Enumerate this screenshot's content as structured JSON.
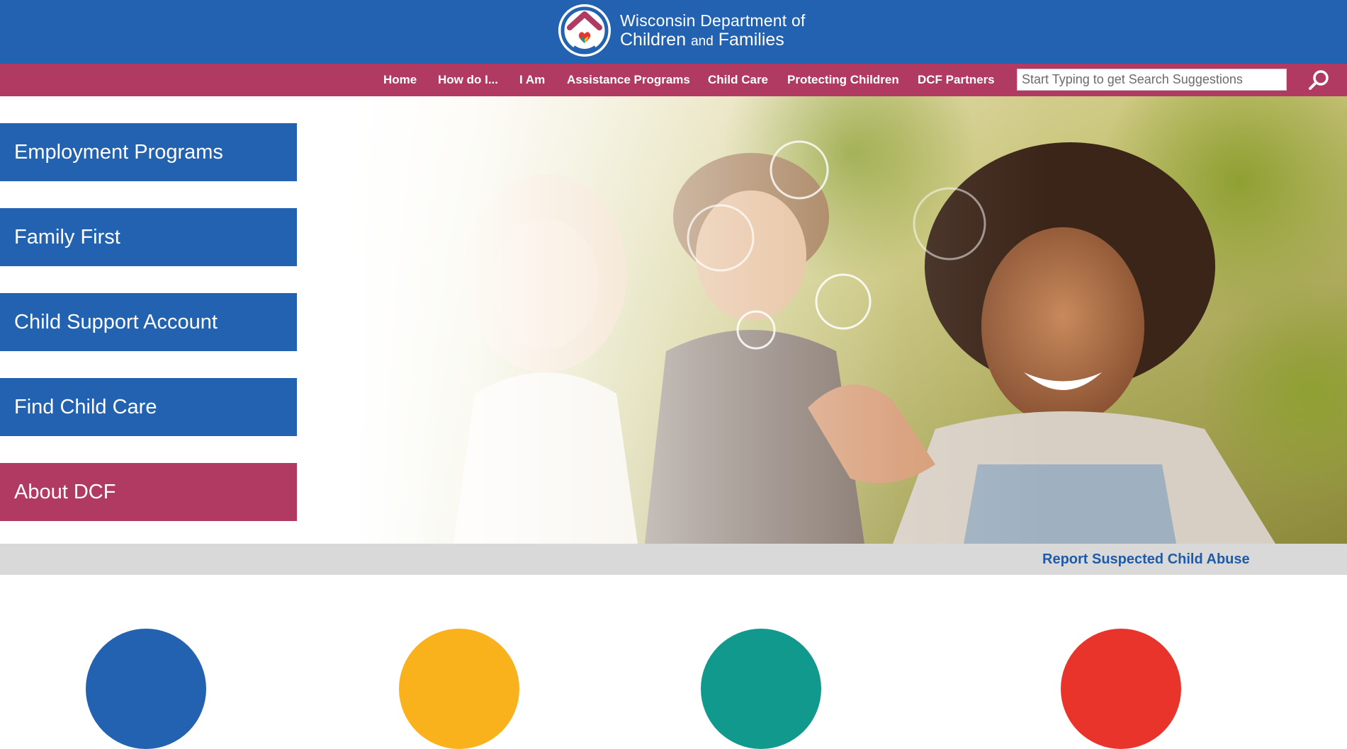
{
  "header": {
    "org_line1": "Wisconsin Department of",
    "org_line2_a": "Children",
    "org_line2_and": "and",
    "org_line2_b": "Families",
    "background_color": "#2262b0",
    "logo_icon": "house-heart-logo"
  },
  "nav": {
    "background_color": "#b03a62",
    "items": [
      {
        "label": "Home"
      },
      {
        "label": "How do I..."
      },
      {
        "label": "I Am"
      },
      {
        "label": "Assistance Programs"
      },
      {
        "label": "Child Care"
      },
      {
        "label": "Protecting Children"
      },
      {
        "label": "DCF Partners"
      }
    ],
    "search": {
      "placeholder": "Start Typing to get Search Suggestions",
      "value": "",
      "icon": "search-icon"
    }
  },
  "sidebar": {
    "buttons": [
      {
        "label": "Employment Programs",
        "color": "#2262b0"
      },
      {
        "label": "Family First",
        "color": "#2262b0"
      },
      {
        "label": "Child Support Account",
        "color": "#2262b0"
      },
      {
        "label": "Find Child Care",
        "color": "#2262b0"
      },
      {
        "label": "About DCF",
        "color": "#b03a62"
      }
    ]
  },
  "alert": {
    "link_label": "Report Suspected Child Abuse",
    "background_color": "#d9d9d9"
  },
  "feature_circles": {
    "colors": [
      "#2262b0",
      "#f9b21b",
      "#11998e",
      "#e8342a"
    ]
  }
}
